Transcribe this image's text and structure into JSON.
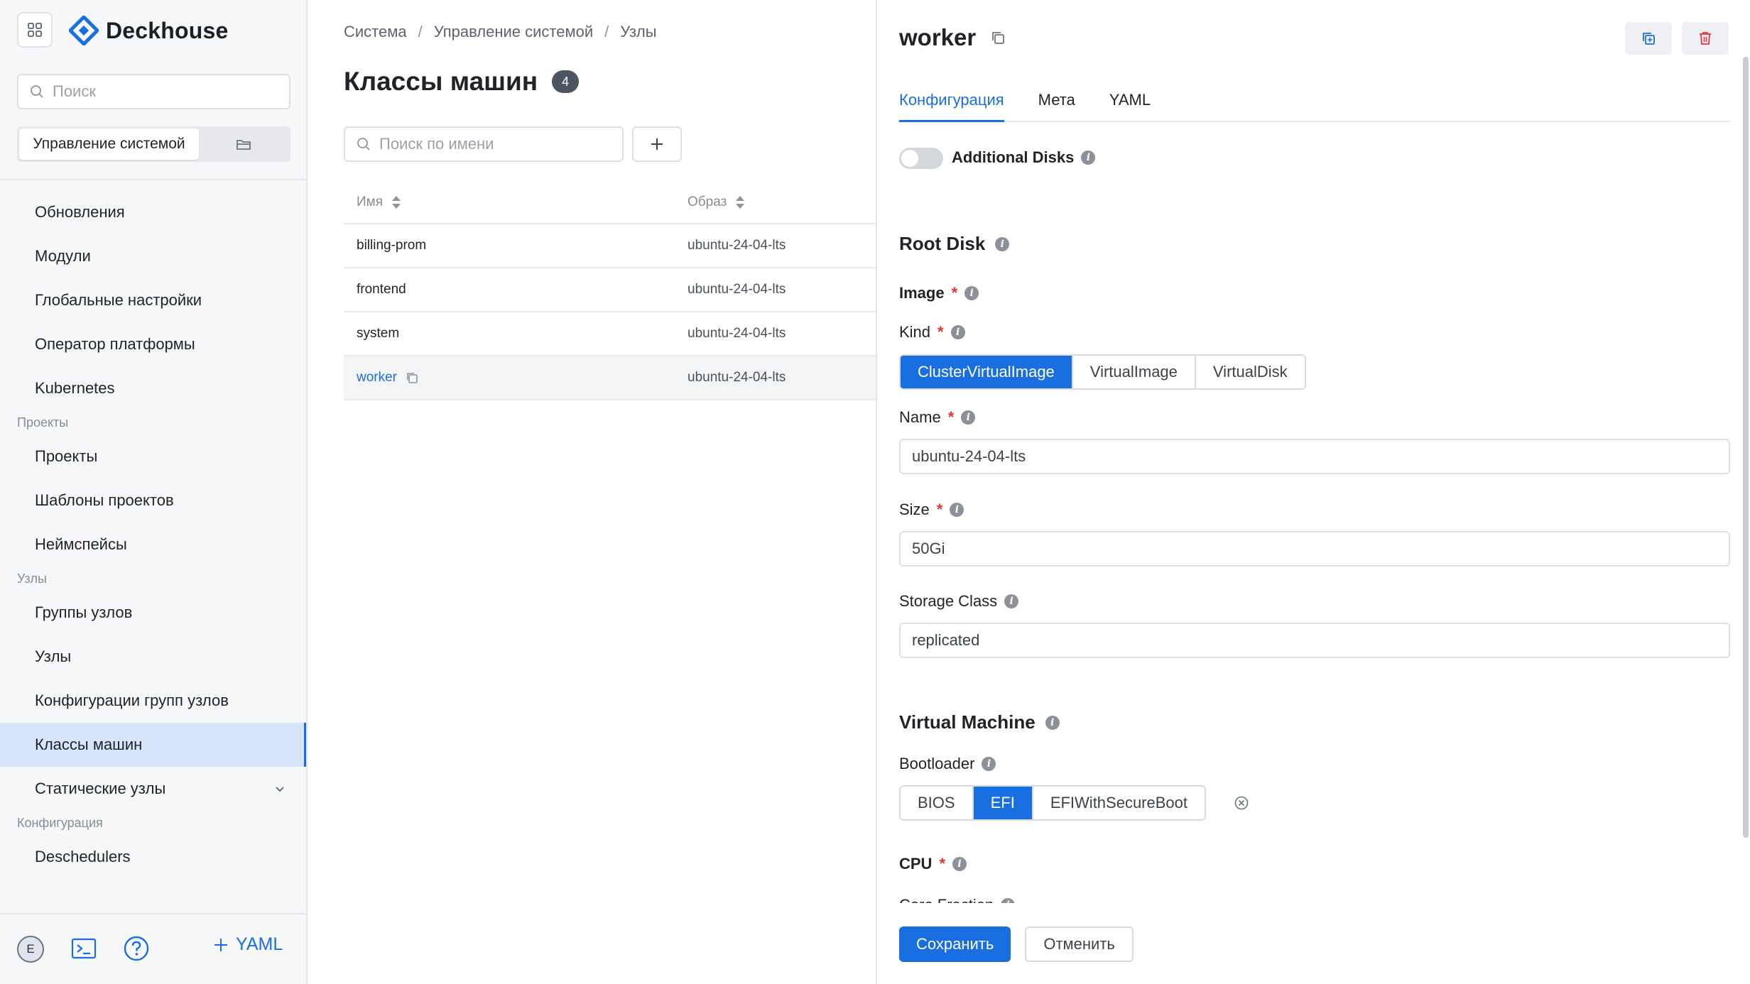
{
  "sidebar": {
    "logo_text": "Deckhouse",
    "search_placeholder": "Поиск",
    "segment_active": "Управление системой",
    "items": [
      {
        "label": "Обновления"
      },
      {
        "label": "Модули"
      },
      {
        "label": "Глобальные настройки"
      },
      {
        "label": "Оператор платформы"
      },
      {
        "label": "Kubernetes"
      }
    ],
    "section_projects": "Проекты",
    "projects_items": [
      {
        "label": "Проекты"
      },
      {
        "label": "Шаблоны проектов"
      },
      {
        "label": "Неймспейсы"
      }
    ],
    "section_nodes": "Узлы",
    "nodes_items": [
      {
        "label": "Группы узлов"
      },
      {
        "label": "Узлы"
      },
      {
        "label": "Конфигурации групп узлов"
      },
      {
        "label": "Классы машин"
      },
      {
        "label": "Статические узлы"
      }
    ],
    "section_config": "Конфигурация",
    "config_items": [
      {
        "label": "Deschedulers"
      }
    ],
    "footer": {
      "avatar_letter": "E",
      "yaml_label": "YAML"
    }
  },
  "main": {
    "breadcrumb": [
      "Система",
      "Управление системой",
      "Узлы"
    ],
    "title": "Классы машин",
    "count": "4",
    "search_placeholder": "Поиск по имени",
    "columns": [
      "Имя",
      "Образ"
    ],
    "rows": [
      {
        "name": "billing-prom",
        "image": "ubuntu-24-04-lts"
      },
      {
        "name": "frontend",
        "image": "ubuntu-24-04-lts"
      },
      {
        "name": "system",
        "image": "ubuntu-24-04-lts"
      },
      {
        "name": "worker",
        "image": "ubuntu-24-04-lts"
      }
    ]
  },
  "panel": {
    "title": "worker",
    "tabs": [
      "Конфигурация",
      "Мета",
      "YAML"
    ],
    "additional_disks_label": "Additional Disks",
    "root_disk_title": "Root Disk",
    "image_label": "Image",
    "kind_label": "Kind",
    "kind_options": [
      "ClusterVirtualImage",
      "VirtualImage",
      "VirtualDisk"
    ],
    "kind_selected": "ClusterVirtualImage",
    "name_label": "Name",
    "name_value": "ubuntu-24-04-lts",
    "size_label": "Size",
    "size_value": "50Gi",
    "storage_class_label": "Storage Class",
    "storage_class_value": "replicated",
    "vm_title": "Virtual Machine",
    "bootloader_label": "Bootloader",
    "bootloader_options": [
      "BIOS",
      "EFI",
      "EFIWithSecureBoot"
    ],
    "bootloader_selected": "EFI",
    "cpu_label": "CPU",
    "core_fraction_label": "Core Fraction",
    "save_label": "Сохранить",
    "cancel_label": "Отменить"
  },
  "colors": {
    "accent": "#1a6fe0",
    "required": "#e5343a",
    "active_nav_bg": "#d6e5fb",
    "delete": "#e5343a"
  }
}
